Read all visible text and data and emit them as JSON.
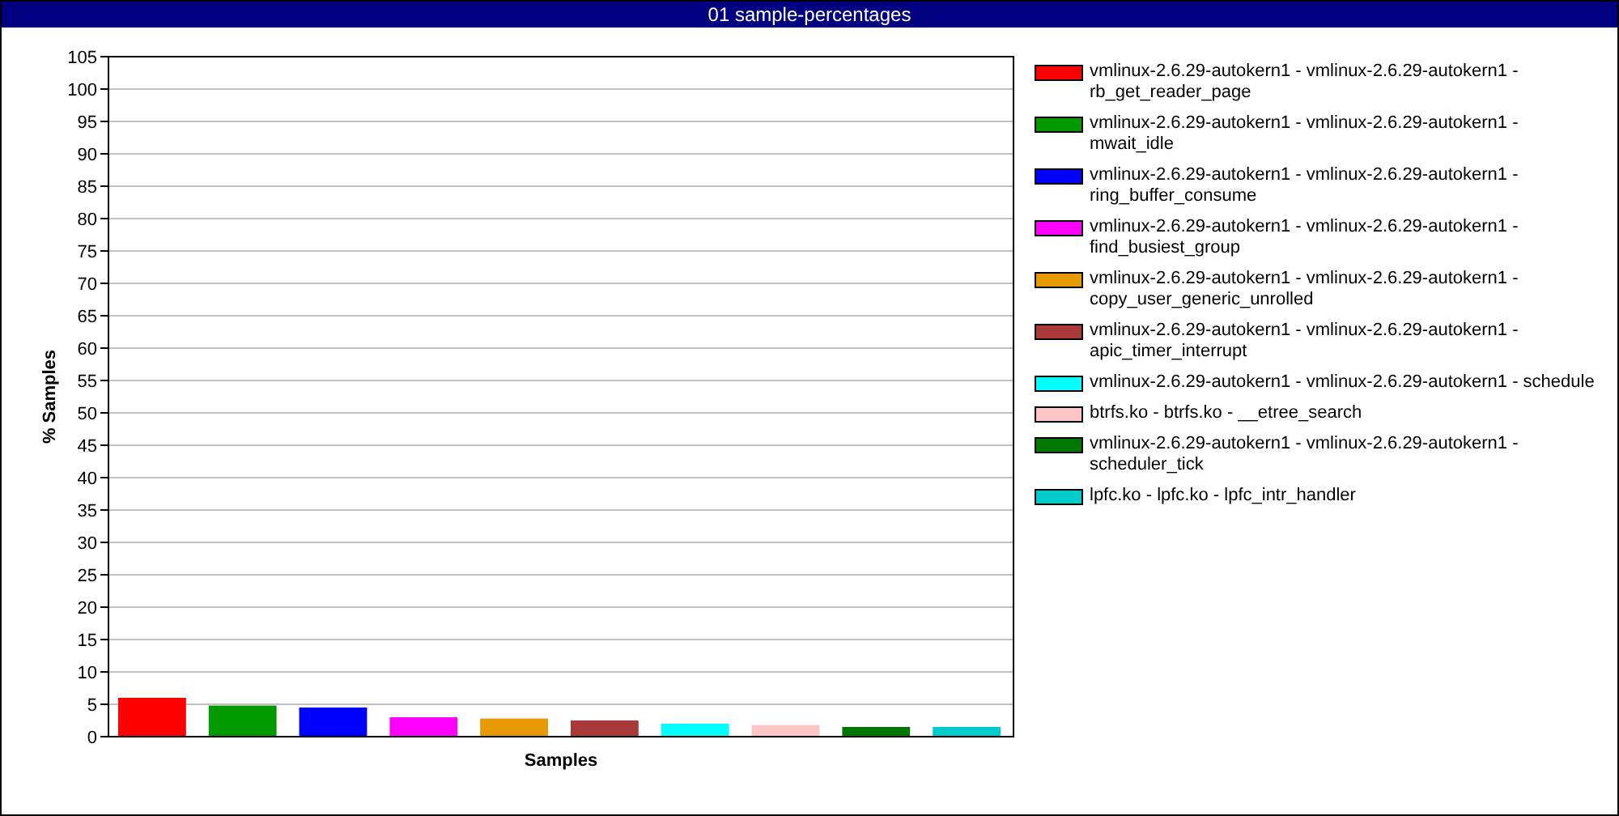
{
  "window": {
    "title": "01 sample-percentages"
  },
  "chart": {
    "chart_data": {
      "type": "bar",
      "xlabel": "Samples",
      "ylabel": "% Samples",
      "grid": true,
      "ylim": [
        0,
        105
      ],
      "yticks": [
        0,
        5,
        10,
        15,
        20,
        25,
        30,
        35,
        40,
        45,
        50,
        55,
        60,
        65,
        70,
        75,
        80,
        85,
        90,
        95,
        100,
        105
      ],
      "series": [
        {
          "name": "vmlinux-2.6.29-autokern1 - vmlinux-2.6.29-autokern1 - rb_get_reader_page",
          "color": "#ff0000",
          "values": [
            6.0
          ]
        },
        {
          "name": "vmlinux-2.6.29-autokern1 - vmlinux-2.6.29-autokern1 - mwait_idle",
          "color": "#009900",
          "values": [
            4.8
          ]
        },
        {
          "name": "vmlinux-2.6.29-autokern1 - vmlinux-2.6.29-autokern1 - ring_buffer_consume",
          "color": "#0000ff",
          "values": [
            4.5
          ]
        },
        {
          "name": "vmlinux-2.6.29-autokern1 - vmlinux-2.6.29-autokern1 - find_busiest_group",
          "color": "#ff00ff",
          "values": [
            3.0
          ]
        },
        {
          "name": "vmlinux-2.6.29-autokern1 - vmlinux-2.6.29-autokern1 - copy_user_generic_unrolled",
          "color": "#e69900",
          "values": [
            2.8
          ]
        },
        {
          "name": "vmlinux-2.6.29-autokern1 - vmlinux-2.6.29-autokern1 - apic_timer_interrupt",
          "color": "#aa3939",
          "values": [
            2.5
          ]
        },
        {
          "name": "vmlinux-2.6.29-autokern1 - vmlinux-2.6.29-autokern1 - schedule",
          "color": "#00ffff",
          "values": [
            2.0
          ]
        },
        {
          "name": "btrfs.ko - btrfs.ko - __etree_search",
          "color": "#ffc6c6",
          "values": [
            1.8
          ]
        },
        {
          "name": "vmlinux-2.6.29-autokern1 - vmlinux-2.6.29-autokern1 - scheduler_tick",
          "color": "#007700",
          "values": [
            1.5
          ]
        },
        {
          "name": "lpfc.ko - lpfc.ko - lpfc_intr_handler",
          "color": "#00cccc",
          "values": [
            1.5
          ]
        }
      ]
    }
  }
}
